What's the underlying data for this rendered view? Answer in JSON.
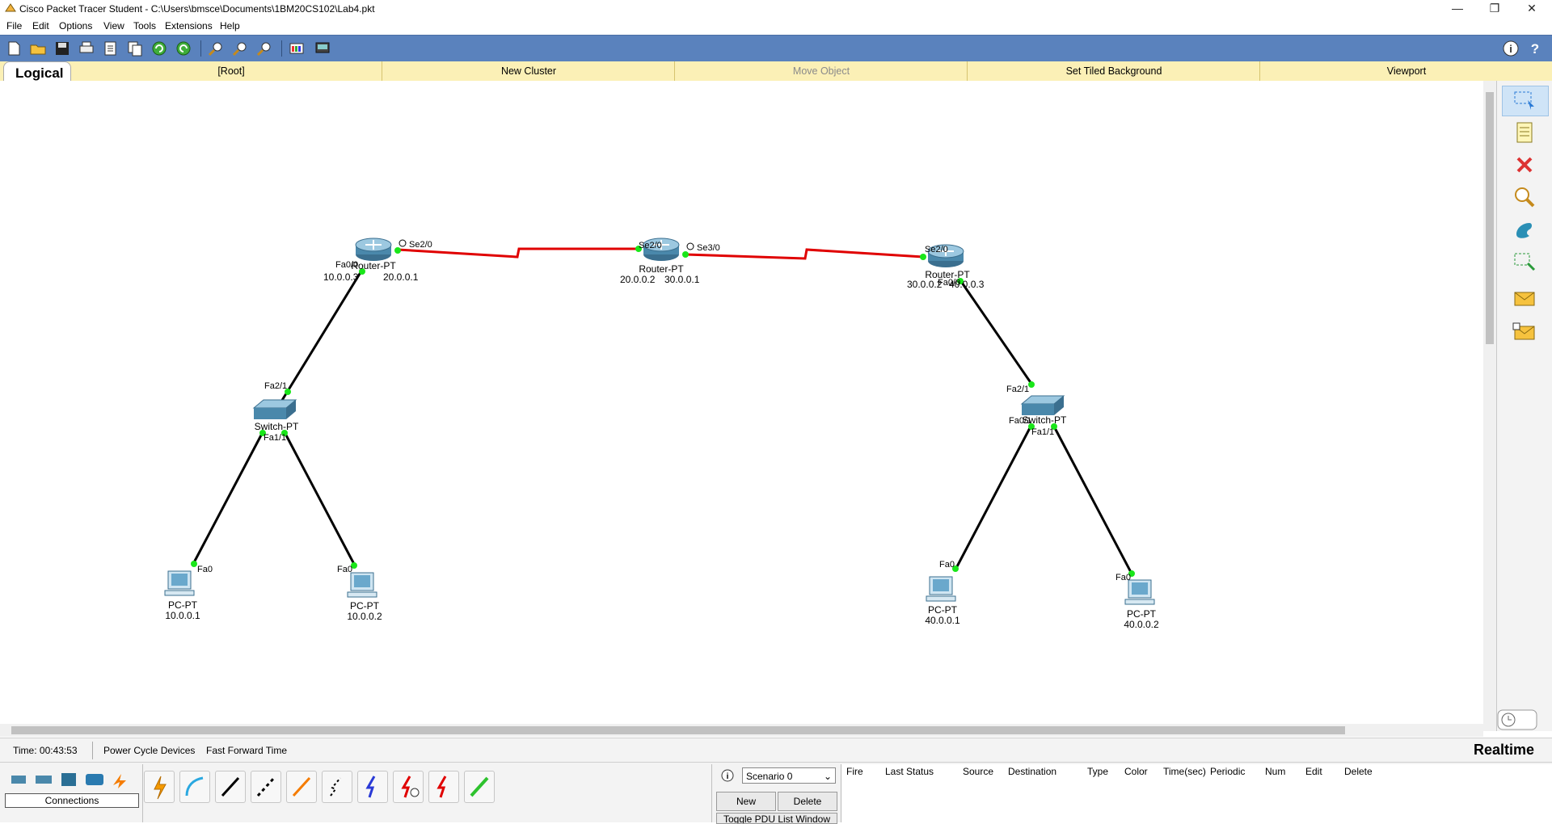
{
  "window": {
    "title": "Cisco Packet Tracer Student - C:\\Users\\bmsce\\Documents\\1BM20CS102\\Lab4.pkt"
  },
  "menu": [
    "File",
    "Edit",
    "Options",
    "View",
    "Tools",
    "Extensions",
    "Help"
  ],
  "workspace": {
    "mode_tab": "Logical",
    "bar_items": [
      "[Root]",
      "New Cluster",
      "Move Object",
      "Set Tiled Background",
      "Viewport"
    ]
  },
  "topology": {
    "routers": [
      {
        "name": "Router-PT",
        "ips": "10.0.0.3",
        "ip2": "20.0.0.1",
        "port_left": "Fa0/0",
        "port_right": "Se2/0"
      },
      {
        "name": "Router-PT",
        "ips": "20.0.0.2",
        "ip2": "30.0.0.1",
        "port_left": "Se2/0",
        "port_right": "Se3/0"
      },
      {
        "name": "Router-PT",
        "ips": "30.0.0.2",
        "ip2": "40.0.0.3",
        "port_left": "Se2/0",
        "port_right": "Fa0/0"
      }
    ],
    "switches": [
      {
        "name": "Switch-PT",
        "up_port": "Fa2/1",
        "down_ports": "Fa1/1",
        "down_ports2": "Fa0/1"
      },
      {
        "name": "Switch-PT",
        "up_port": "Fa2/1",
        "down_ports": "Fa0/1",
        "down_ports2": "Fa1/1"
      }
    ],
    "pcs": [
      {
        "name": "PC-PT",
        "ip": "10.0.0.1",
        "port": "Fa0"
      },
      {
        "name": "PC-PT",
        "ip": "10.0.0.2",
        "port": "Fa0"
      },
      {
        "name": "PC-PT",
        "ip": "40.0.0.1",
        "port": "Fa0"
      },
      {
        "name": "PC-PT",
        "ip": "40.0.0.2",
        "port": "Fa0"
      }
    ]
  },
  "status": {
    "time": "Time: 00:43:53",
    "power_cycle": "Power Cycle Devices",
    "fast_forward": "Fast Forward Time",
    "mode": "Realtime"
  },
  "bottom": {
    "category_label": "Connections",
    "scenario_value": "Scenario 0",
    "new_button": "New",
    "delete_button": "Delete",
    "toggle_pdu": "Toggle PDU List Window",
    "pdu_columns": [
      "Fire",
      "Last Status",
      "Source",
      "Destination",
      "Type",
      "Color",
      "Time(sec)",
      "Periodic",
      "Num",
      "Edit",
      "Delete"
    ]
  },
  "colors": {
    "toolbar": "#5a82bd",
    "logical_bar": "#fbf0b6",
    "serial_link": "#e00000",
    "ethernet_link": "#000000",
    "port_light": "#19e619"
  }
}
